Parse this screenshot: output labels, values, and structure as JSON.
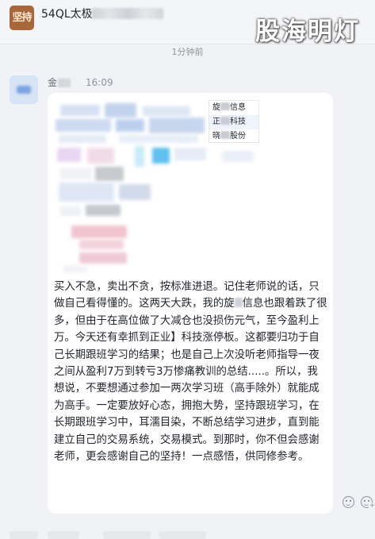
{
  "header": {
    "group_title": "54QL太极",
    "avatar_glyph": "坚持",
    "watermark": "股海明灯"
  },
  "timestamp": "1分钟前",
  "message": {
    "sender_prefix": "金",
    "time": "16:09",
    "stocks": [
      {
        "pre": "旋",
        "post": "信息"
      },
      {
        "pre": "正",
        "post": "科技"
      },
      {
        "pre": "晓",
        "post": "股份"
      }
    ],
    "text_before": "买入不急，卖出不贪，按标准进退。记住老师说的话，只做自己看得懂的。这两天大跌，我的旋",
    "text_after": "信息也跟着跌了很多，但由于在高位做了大减仓也没损伤元气，至今盈利上万。今天还有幸抓到正业】科技涨停板。这都要归功于自己长期跟班学习的结果；也是自己上次没听老师指导一夜之间从盈利7万到转亏3万惨痛教训的总结.....。所以，我想说，不要想通过参加一两次学习班（高手除外）就能成为高手。一定要放好心态，拥抱大势，坚持跟班学习，在长期跟班学习中，耳濡目染，不断总结学习进步，直到能建立自己的交易系统，交易模式。到那时，你不但会感谢老师，更会感谢自己的坚持！一点感悟，供同修参考。"
  },
  "icons": {
    "emoji_reaction": "emoji-reaction-icon",
    "add_reaction": "add-reaction-icon"
  },
  "colors": {
    "page_bg": "#f1f2f6",
    "bubble_bg": "#ffffff",
    "avatar_brown": "#a8673a",
    "highlight_row": "#eef3fd"
  }
}
